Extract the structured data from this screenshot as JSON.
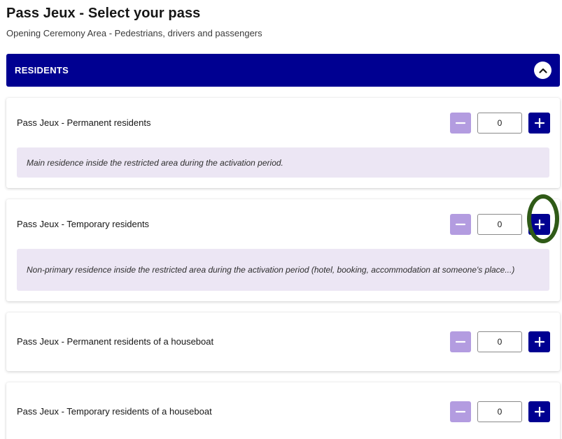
{
  "page": {
    "title": "Pass Jeux - Select your pass",
    "subtitle": "Opening Ceremony Area - Pedestrians, drivers and passengers"
  },
  "section": {
    "label": "RESIDENTS",
    "collapse_icon": "chevron-up-icon",
    "header_color": "#000091"
  },
  "passes": [
    {
      "title": "Pass Jeux - Permanent residents",
      "quantity": "0",
      "description": "Main residence inside the restricted area during the activation period."
    },
    {
      "title": "Pass Jeux - Temporary residents",
      "quantity": "0",
      "description": "Non-primary residence inside the restricted area during the activation period (hotel, booking, accommodation at someone's place...)"
    },
    {
      "title": "Pass Jeux - Permanent residents of a houseboat",
      "quantity": "0",
      "description": ""
    },
    {
      "title": "Pass Jeux - Temporary residents of a houseboat",
      "quantity": "0",
      "description": ""
    }
  ],
  "stepper": {
    "minus_icon": "minus-icon",
    "plus_icon": "plus-icon",
    "minus_color": "#b39ce0",
    "plus_color": "#000091"
  },
  "annotation": {
    "highlight_color": "#2f5a17"
  }
}
